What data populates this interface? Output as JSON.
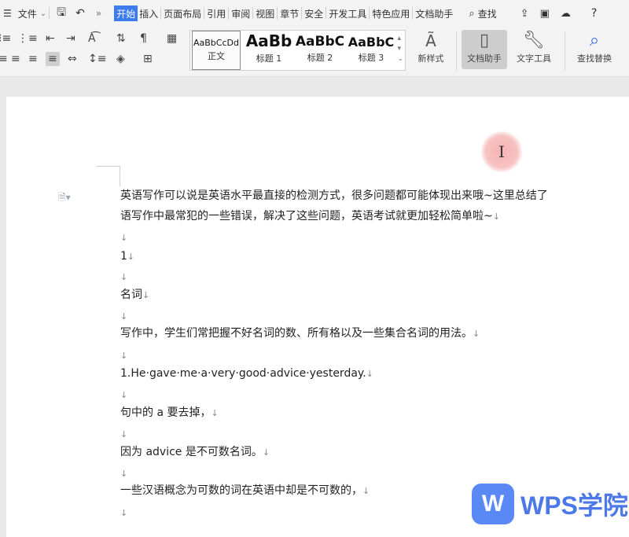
{
  "menubar": {
    "file_label": "文件",
    "tabs": [
      "开始",
      "插入",
      "页面布局",
      "引用",
      "审阅",
      "视图",
      "章节",
      "安全",
      "开发工具",
      "特色应用",
      "文档助手"
    ],
    "search_label": "查找"
  },
  "ribbon": {
    "styles": [
      {
        "preview": "AaBbCcDd",
        "label": "正文"
      },
      {
        "preview": "AaBb",
        "label": "标题 1"
      },
      {
        "preview": "AaBbC",
        "label": "标题 2"
      },
      {
        "preview": "AaBbC",
        "label": "标题 3"
      }
    ],
    "new_style_label": "新样式",
    "doc_assistant_label": "文档助手",
    "text_tools_label": "文字工具",
    "find_replace_label": "查找替换"
  },
  "document": {
    "paragraphs": [
      "英语写作可以说是英语水平最直接的检测方式，很多问题都可能体现出来哦~这里总结了",
      "语写作中最常犯的一些错误，解决了这些问题，英语考试就更加轻松简单啦~",
      "1",
      "名词",
      "写作中，学生们常把握不好名词的数、所有格以及一些集合名词的用法。",
      "1.He·gave·me·a·very·good·advice·yesterday.",
      "句中的 a 要去掉，",
      "因为 advice 是不可数名词。",
      "一些汉语概念为可数的词在英语中却是不可数的，"
    ],
    "para_mark": "↓"
  },
  "watermark": {
    "logo_letter": "W",
    "text": "WPS学院"
  }
}
